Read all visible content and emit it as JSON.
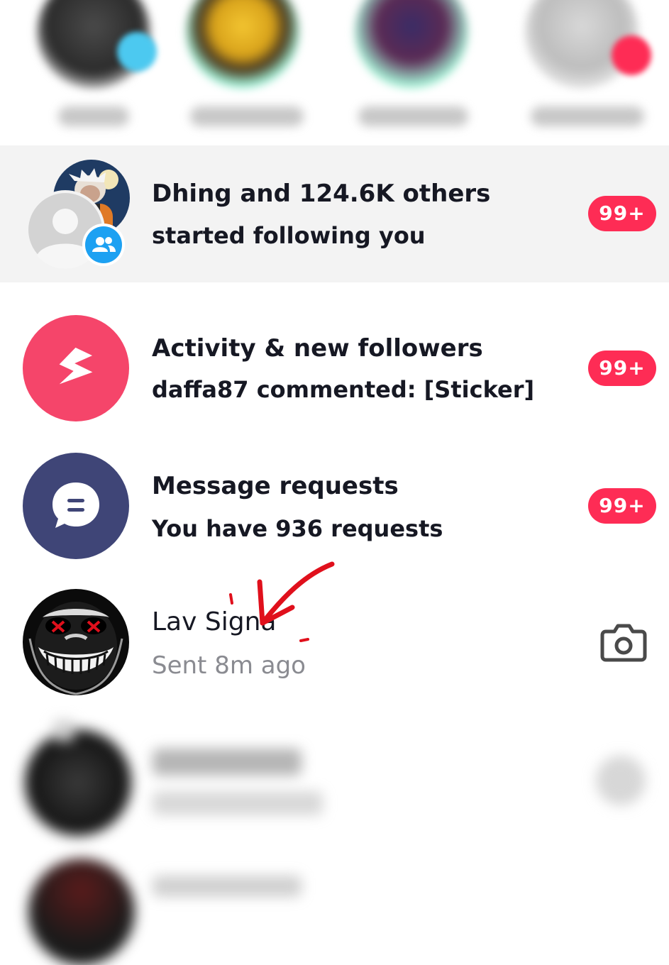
{
  "colors": {
    "badge": "#fe2c55",
    "activity_icon_bg": "#f5456a",
    "requests_icon_bg": "#3f4577",
    "followers_badge_icon": "#1da1f2",
    "annotation": "#e0101c"
  },
  "followers_row": {
    "title": "Dhing and 124.6K others",
    "subtitle": "started following you",
    "badge": "99+",
    "icon": "group-icon"
  },
  "activity_row": {
    "title": "Activity & new followers",
    "subtitle": "daffa87 commented: [Sticker]",
    "badge": "99+",
    "icon": "lightning-icon"
  },
  "requests_row": {
    "title": "Message requests",
    "subtitle": "You have 936 requests",
    "badge": "99+",
    "icon": "chat-bubble-icon"
  },
  "chat_row": {
    "name": "Lav Signa",
    "status": "Sent 8m ago",
    "action_icon": "camera-icon"
  }
}
